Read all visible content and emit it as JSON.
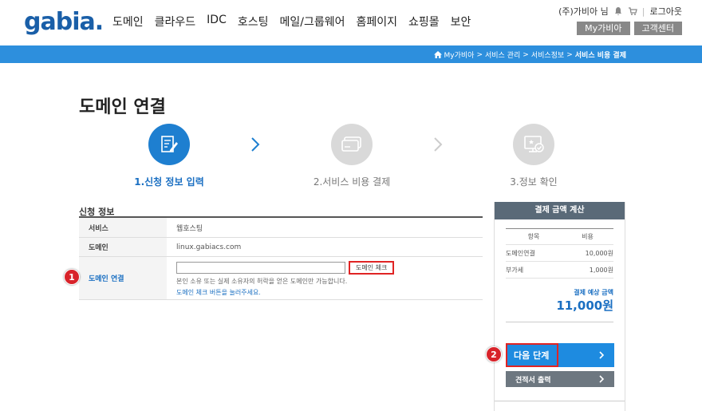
{
  "header": {
    "logo": "gabia.",
    "gnb": [
      "도메인",
      "클라우드",
      "IDC",
      "호스팅",
      "메일/그룹웨어",
      "홈페이지",
      "쇼핑몰",
      "보안"
    ],
    "user": "(주)가비아 님",
    "logout": "로그아웃",
    "my_button": "My가비아",
    "support_button": "고객센터"
  },
  "breadcrumb": {
    "items": [
      "My가비아",
      "서비스 관리",
      "서비스정보"
    ],
    "current": "서비스 비용 결제",
    "separator": ">"
  },
  "page_title": "도메인 연결",
  "steps": [
    {
      "label": "1.신청 정보 입력",
      "state": "active",
      "icon": "document-edit-icon"
    },
    {
      "label": "2.서비스 비용 결제",
      "state": "inactive",
      "icon": "card-icon"
    },
    {
      "label": "3.정보 확인",
      "state": "inactive",
      "icon": "monitor-check-icon"
    }
  ],
  "form": {
    "section_title": "신청 정보",
    "service_label": "서비스",
    "service_value": "웹호스팅",
    "domain_label": "도메인",
    "domain_value": "linux.gabiacs.com",
    "connect_label": "도메인 연결",
    "connect_input_value": "",
    "check_button": "도메인 체크",
    "help_text": "본인 소유 또는 실제 소유자의 허락을 얻은 도메인만 가능합니다.",
    "help_link": "도메인 체크 버튼을 눌러주세요."
  },
  "payment": {
    "title": "결제 금액 계산",
    "col_item": "항목",
    "col_cost": "비용",
    "rows": [
      {
        "item": "도메인연결",
        "cost": "10,000원"
      },
      {
        "item": "부가세",
        "cost": "1,000원"
      }
    ],
    "total_label": "결제 예상 금액",
    "total_amount": "11,000원",
    "next_button": "다음 단계",
    "quote_button": "견적서 출력"
  },
  "annotations": {
    "badge1": "1",
    "badge2": "2"
  },
  "colors": {
    "brand_blue": "#2d8fdd",
    "active_step": "#1e7fd0",
    "highlight_red": "#e02424",
    "panel_header": "#5a6a78"
  }
}
